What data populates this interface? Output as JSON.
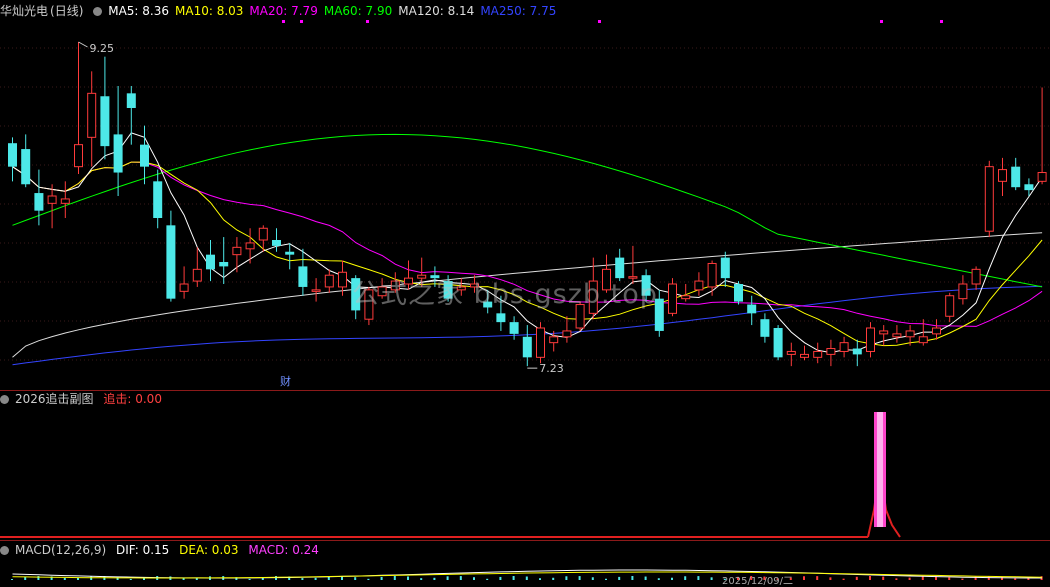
{
  "main_panel": {
    "stock_name": "华灿光电",
    "period": "(日线)",
    "ma_items": [
      {
        "label": "MA5: 8.36",
        "color": "#ffffff"
      },
      {
        "label": "MA10: 8.03",
        "color": "#ffff00"
      },
      {
        "label": "MA20: 7.79",
        "color": "#ff00ff"
      },
      {
        "label": "MA60: 7.90",
        "color": "#00ff00"
      },
      {
        "label": "MA120: 8.14",
        "color": "#dddddd"
      },
      {
        "label": "MA250: 7.75",
        "color": "#3344ff"
      }
    ],
    "high_label": "9.25",
    "low_label": "7.23",
    "fin_marker": "财"
  },
  "sub_panel_1": {
    "title": "2026追击副图",
    "value_label": "追击: 0.00"
  },
  "sub_panel_2": {
    "title": "MACD(12,26,9)",
    "dif_label": "DIF: 0.15",
    "dea_label": "DEA: 0.03",
    "macd_label": "MACD: 0.24",
    "date_label": "2025/12/09/二"
  },
  "watermark": "公式之家 bbs.gszb.top",
  "chart_data": {
    "type": "candlestick",
    "title": "华灿光电 (日线)",
    "ylim": [
      7.0,
      9.4
    ],
    "candles": [
      [
        8.56,
        8.6,
        8.3,
        8.4
      ],
      [
        8.52,
        8.62,
        8.26,
        8.28
      ],
      [
        8.22,
        8.38,
        8.0,
        8.1
      ],
      [
        8.15,
        8.28,
        7.98,
        8.2
      ],
      [
        8.15,
        8.3,
        8.05,
        8.18
      ],
      [
        8.4,
        9.25,
        8.35,
        8.55
      ],
      [
        8.6,
        9.05,
        8.4,
        8.9
      ],
      [
        8.88,
        9.15,
        8.45,
        8.54
      ],
      [
        8.62,
        8.95,
        8.2,
        8.36
      ],
      [
        8.9,
        8.95,
        8.55,
        8.8
      ],
      [
        8.55,
        8.68,
        8.28,
        8.4
      ],
      [
        8.3,
        8.38,
        7.98,
        8.05
      ],
      [
        8.0,
        8.1,
        7.48,
        7.5
      ],
      [
        7.55,
        7.72,
        7.5,
        7.6
      ],
      [
        7.62,
        7.85,
        7.58,
        7.7
      ],
      [
        7.8,
        7.9,
        7.62,
        7.7
      ],
      [
        7.75,
        7.92,
        7.6,
        7.72
      ],
      [
        7.8,
        7.92,
        7.68,
        7.85
      ],
      [
        7.84,
        7.98,
        7.74,
        7.88
      ],
      [
        7.9,
        8.0,
        7.82,
        7.98
      ],
      [
        7.9,
        7.98,
        7.82,
        7.86
      ],
      [
        7.82,
        7.88,
        7.7,
        7.8
      ],
      [
        7.72,
        7.84,
        7.52,
        7.58
      ],
      [
        7.55,
        7.64,
        7.48,
        7.56
      ],
      [
        7.58,
        7.7,
        7.54,
        7.66
      ],
      [
        7.58,
        7.76,
        7.52,
        7.68
      ],
      [
        7.64,
        7.66,
        7.36,
        7.42
      ],
      [
        7.36,
        7.58,
        7.32,
        7.56
      ],
      [
        7.52,
        7.64,
        7.5,
        7.58
      ],
      [
        7.56,
        7.68,
        7.54,
        7.62
      ],
      [
        7.6,
        7.76,
        7.56,
        7.64
      ],
      [
        7.64,
        7.78,
        7.58,
        7.66
      ],
      [
        7.66,
        7.72,
        7.58,
        7.64
      ],
      [
        7.62,
        7.66,
        7.48,
        7.5
      ],
      [
        7.56,
        7.64,
        7.52,
        7.58
      ],
      [
        7.58,
        7.66,
        7.54,
        7.6
      ],
      [
        7.48,
        7.56,
        7.4,
        7.44
      ],
      [
        7.4,
        7.52,
        7.28,
        7.34
      ],
      [
        7.34,
        7.38,
        7.22,
        7.26
      ],
      [
        7.24,
        7.32,
        7.04,
        7.1
      ],
      [
        7.1,
        7.34,
        7.06,
        7.3
      ],
      [
        7.2,
        7.28,
        7.14,
        7.24
      ],
      [
        7.24,
        7.38,
        7.2,
        7.28
      ],
      [
        7.3,
        7.48,
        7.28,
        7.46
      ],
      [
        7.4,
        7.78,
        7.36,
        7.62
      ],
      [
        7.56,
        7.8,
        7.54,
        7.7
      ],
      [
        7.78,
        7.84,
        7.62,
        7.64
      ],
      [
        7.65,
        7.86,
        7.6,
        7.65
      ],
      [
        7.66,
        7.7,
        7.48,
        7.52
      ],
      [
        7.5,
        7.56,
        7.24,
        7.28
      ],
      [
        7.4,
        7.64,
        7.38,
        7.6
      ],
      [
        7.5,
        7.6,
        7.48,
        7.52
      ],
      [
        7.56,
        7.68,
        7.52,
        7.62
      ],
      [
        7.58,
        7.76,
        7.52,
        7.74
      ],
      [
        7.78,
        7.82,
        7.58,
        7.64
      ],
      [
        7.6,
        7.62,
        7.46,
        7.48
      ],
      [
        7.46,
        7.52,
        7.32,
        7.4
      ],
      [
        7.36,
        7.4,
        7.2,
        7.24
      ],
      [
        7.3,
        7.32,
        7.08,
        7.1
      ],
      [
        7.12,
        7.2,
        7.04,
        7.14
      ],
      [
        7.1,
        7.18,
        7.08,
        7.12
      ],
      [
        7.1,
        7.2,
        7.06,
        7.14
      ],
      [
        7.12,
        7.22,
        7.04,
        7.16
      ],
      [
        7.14,
        7.24,
        7.1,
        7.2
      ],
      [
        7.16,
        7.22,
        7.04,
        7.12
      ],
      [
        7.14,
        7.34,
        7.1,
        7.3
      ],
      [
        7.26,
        7.32,
        7.18,
        7.28
      ],
      [
        7.24,
        7.32,
        7.2,
        7.26
      ],
      [
        7.24,
        7.32,
        7.18,
        7.28
      ],
      [
        7.2,
        7.36,
        7.18,
        7.24
      ],
      [
        7.26,
        7.36,
        7.22,
        7.3
      ],
      [
        7.38,
        7.54,
        7.34,
        7.52
      ],
      [
        7.5,
        7.66,
        7.46,
        7.6
      ],
      [
        7.6,
        7.72,
        7.56,
        7.7
      ],
      [
        7.96,
        8.44,
        7.92,
        8.4
      ],
      [
        8.3,
        8.46,
        8.2,
        8.38
      ],
      [
        8.4,
        8.46,
        8.24,
        8.26
      ],
      [
        8.28,
        8.32,
        8.2,
        8.24
      ],
      [
        8.3,
        8.94,
        8.28,
        8.36
      ]
    ],
    "ma_lines": [
      {
        "name": "MA5",
        "color": "#ffffff"
      },
      {
        "name": "MA10",
        "color": "#ffff00"
      },
      {
        "name": "MA20",
        "color": "#ff00ff"
      },
      {
        "name": "MA60",
        "color": "#00ff00"
      },
      {
        "name": "MA120",
        "color": "#dddddd"
      },
      {
        "name": "MA250",
        "color": "#3344ff"
      }
    ]
  }
}
